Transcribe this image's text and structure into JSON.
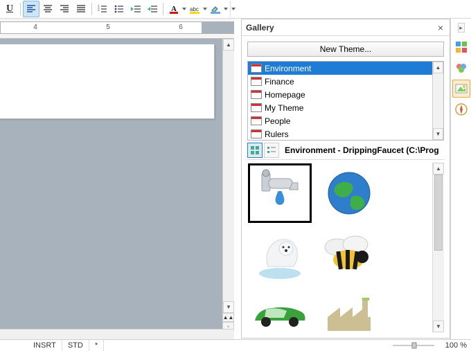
{
  "toolbar": {
    "underline_label": "U"
  },
  "ruler": {
    "numbers": [
      "4",
      "5",
      "6"
    ]
  },
  "gallery": {
    "title": "Gallery",
    "new_theme": "New Theme...",
    "themes": [
      "Environment",
      "Finance",
      "Homepage",
      "My Theme",
      "People",
      "Rulers"
    ],
    "selected_index": 0,
    "info_text": "Environment - DrippingFaucet (C:\\Prog",
    "thumbs": [
      "DrippingFaucet",
      "Earth",
      "PolarBear",
      "Bee",
      "Car",
      "Factory"
    ]
  },
  "status": {
    "insert": "INSRT",
    "std": "STD",
    "star": "*",
    "zoom_percent": "100 %"
  },
  "icons": {
    "align_left": "align-left-icon",
    "align_center": "align-center-icon",
    "align_right": "align-right-icon",
    "align_justify": "align-justify-icon",
    "list_number": "list-number-icon",
    "list_bullet": "list-bullet-icon",
    "indent_decrease": "indent-decrease-icon",
    "indent_increase": "indent-increase-icon",
    "font_color": "font-color-icon",
    "highlight": "highlight-icon",
    "bg_color": "background-color-icon"
  }
}
